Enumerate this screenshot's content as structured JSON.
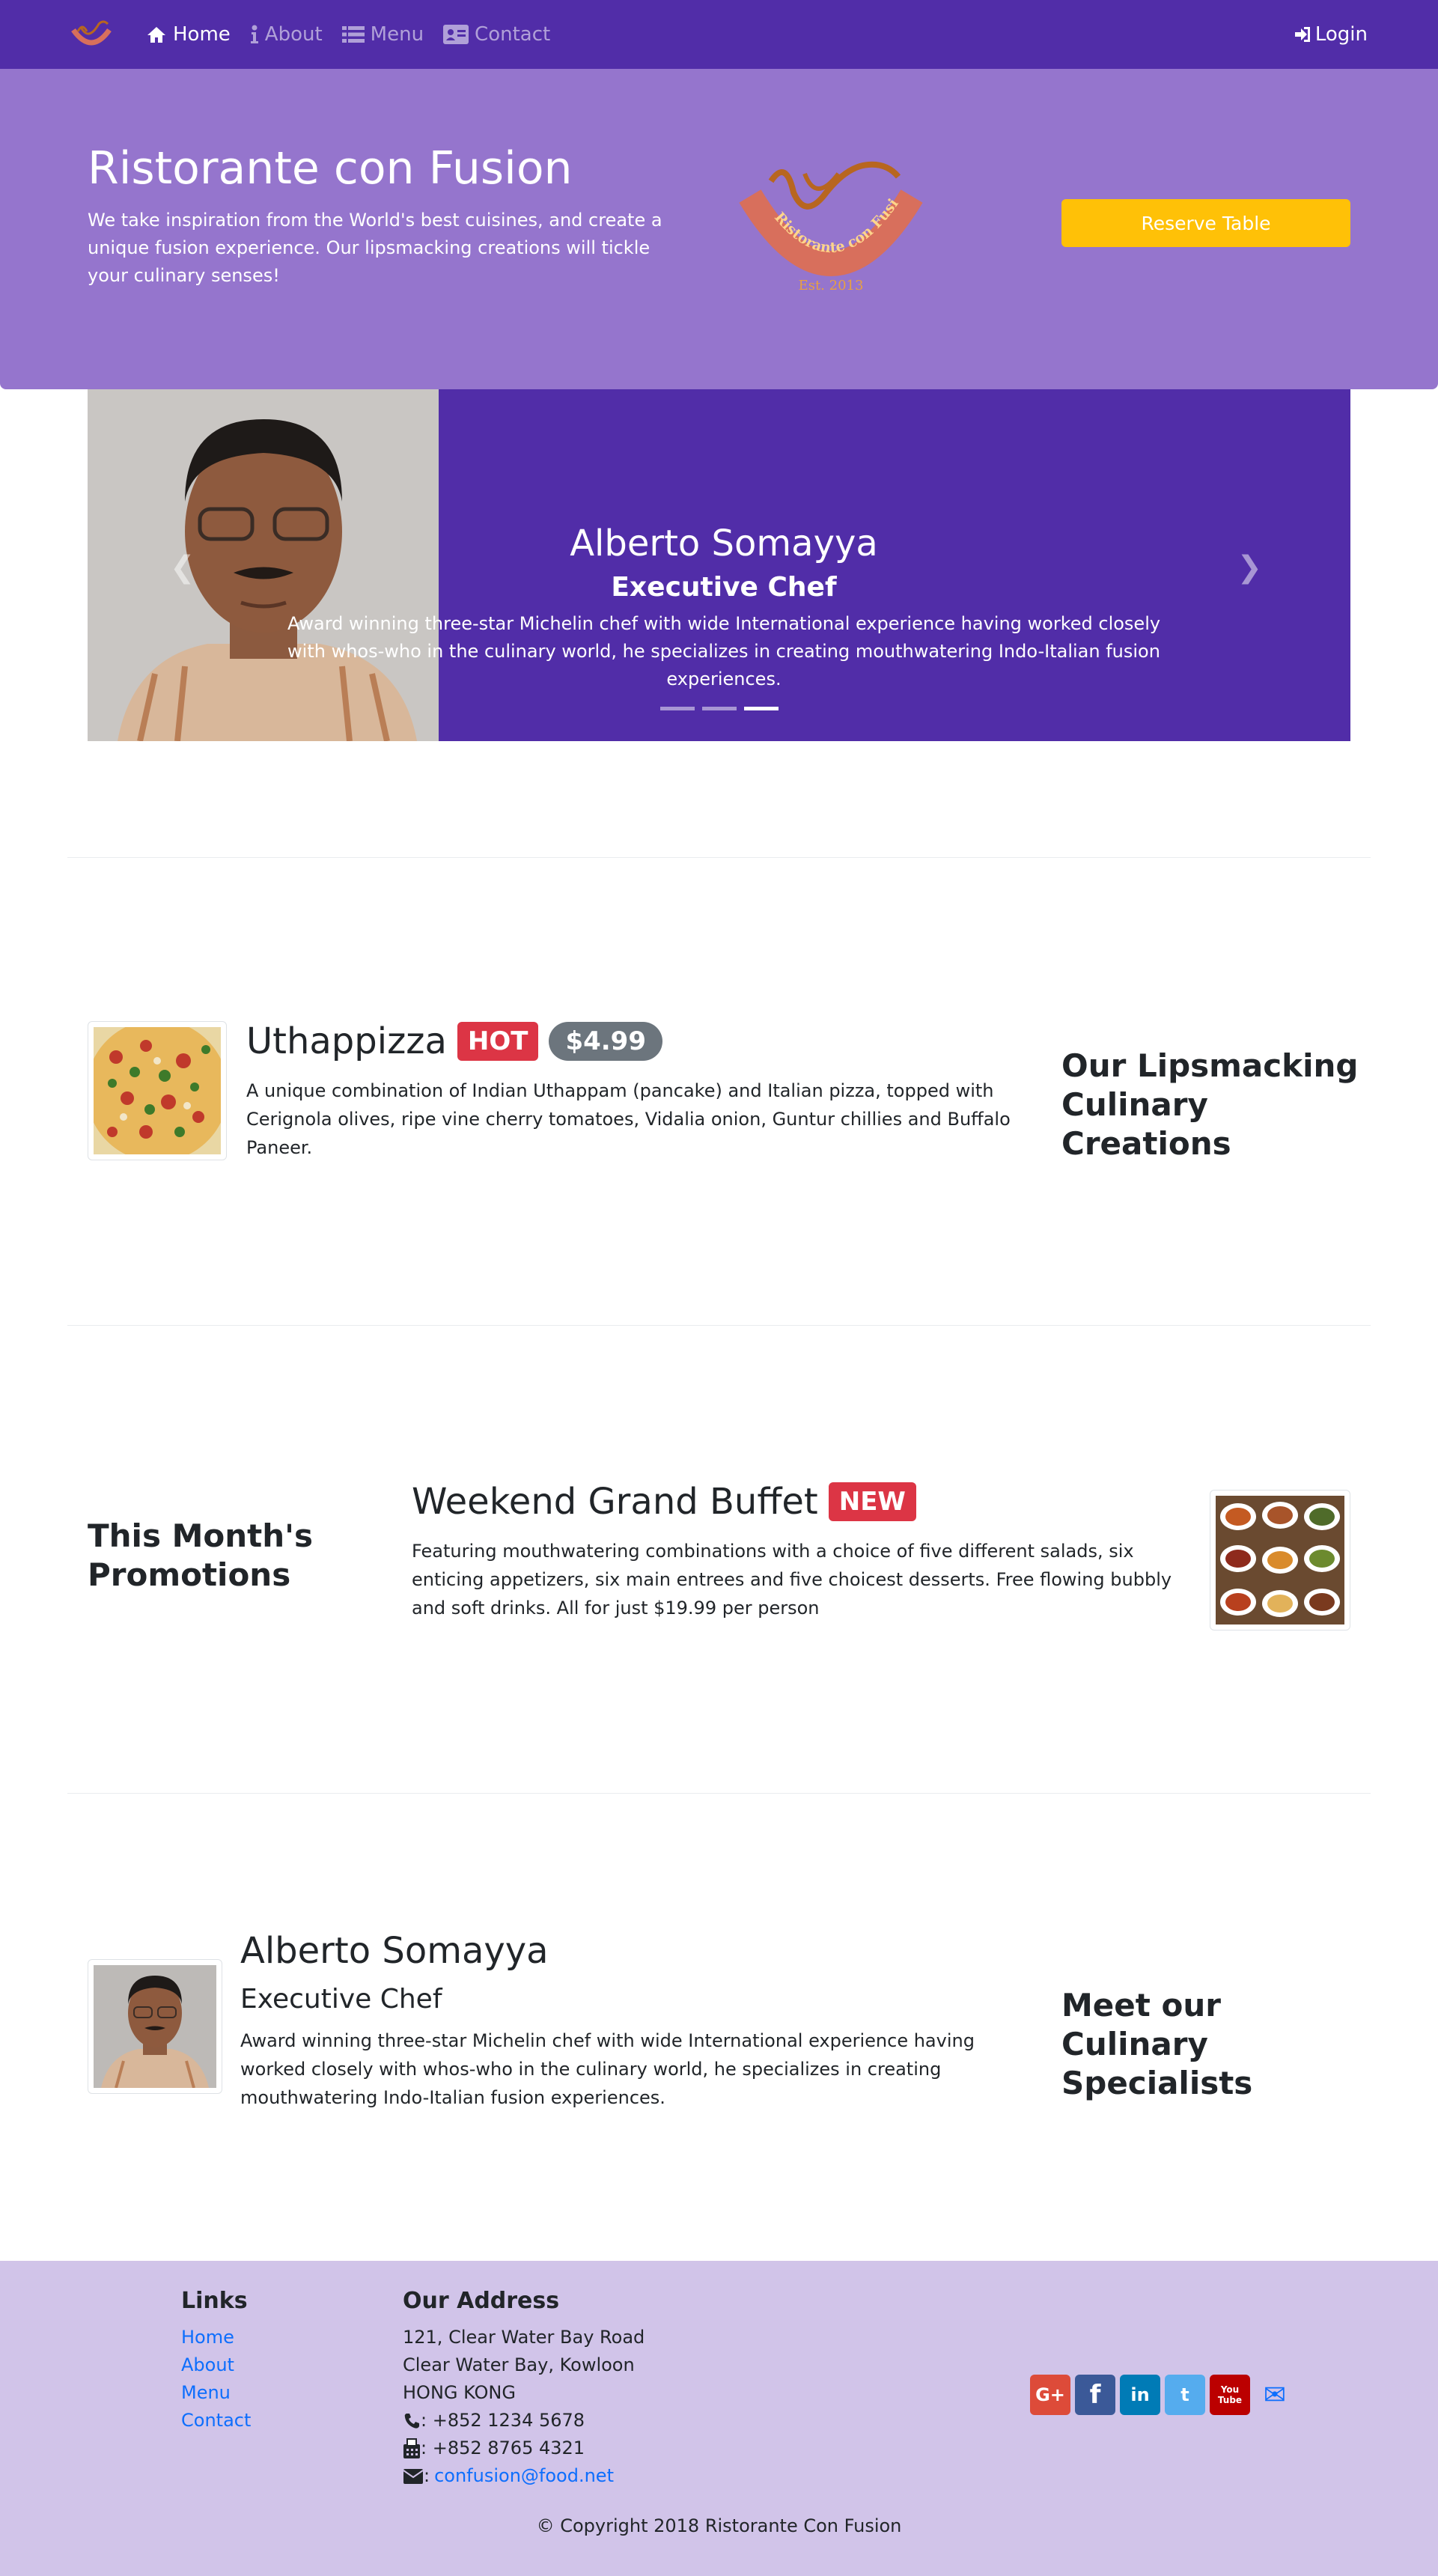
{
  "navbar": {
    "items": [
      {
        "label": "Home",
        "icon": "home-icon",
        "active": true
      },
      {
        "label": "About",
        "icon": "info-icon",
        "active": false
      },
      {
        "label": "Menu",
        "icon": "list-icon",
        "active": false
      },
      {
        "label": "Contact",
        "icon": "address-card-icon",
        "active": false
      }
    ],
    "login_label": "Login"
  },
  "jumbotron": {
    "title": "Ristorante con Fusion",
    "text": "We take inspiration from the World's best cuisines, and create a unique fusion experience. Our lipsmacking creations will tickle your culinary senses!",
    "logo_text": "Ristorante con Fusion",
    "logo_est": "Est. 2013",
    "reserve_label": "Reserve Table"
  },
  "carousel": {
    "name": "Alberto Somayya",
    "role": "Executive Chef",
    "text": "Award winning three-star Michelin chef with wide International experience having worked closely with whos-who in the culinary world, he specializes in creating mouthwatering Indo-Italian fusion experiences.",
    "active_index": 2,
    "slide_count": 3
  },
  "dish": {
    "name": "Uthappizza",
    "badge": "HOT",
    "price": "$4.99",
    "text": "A unique combination of Indian Uthappam (pancake) and Italian pizza, topped with Cerignola olives, ripe vine cherry tomatoes, Vidalia onion, Guntur chillies and Buffalo Paneer.",
    "side_heading": "Our Lipsmacking Culinary Creations"
  },
  "promotion": {
    "name": "Weekend Grand Buffet",
    "badge": "NEW",
    "text": "Featuring mouthwatering combinations with a choice of five different salads, six enticing appetizers, six main entrees and five choicest desserts. Free flowing bubbly and soft drinks. All for just $19.99 per person",
    "side_heading": "This Month's Promotions"
  },
  "leader": {
    "name": "Alberto Somayya",
    "role": "Executive Chef",
    "text": "Award winning three-star Michelin chef with wide International experience having worked closely with whos-who in the culinary world, he specializes in creating mouthwatering Indo-Italian fusion experiences.",
    "side_heading": "Meet our Culinary Specialists"
  },
  "footer": {
    "links_heading": "Links",
    "links": [
      "Home",
      "About",
      "Menu",
      "Contact"
    ],
    "address_heading": "Our Address",
    "address_lines": [
      "121, Clear Water Bay Road",
      "Clear Water Bay, Kowloon",
      "HONG KONG"
    ],
    "phone": ": +852 1234 5678",
    "fax": ": +852 8765 4321",
    "email_prefix": ":",
    "email": "confusion@food.net",
    "social": [
      {
        "name": "google-plus-icon",
        "label": "G+",
        "color": "#DD4B39"
      },
      {
        "name": "facebook-icon",
        "label": "f",
        "color": "#3B5998"
      },
      {
        "name": "linkedin-icon",
        "label": "in",
        "color": "#007BB6"
      },
      {
        "name": "twitter-icon",
        "label": "t",
        "color": "#55ACEE"
      },
      {
        "name": "youtube-icon",
        "label": "You Tube",
        "color": "#BB0000"
      },
      {
        "name": "mail-icon",
        "label": "✉",
        "color": "#0d6efd"
      }
    ],
    "copyright": "© Copyright 2018 Ristorante Con Fusion"
  },
  "colors": {
    "primary": "#512DA8",
    "primary_light": "#9575CD",
    "footer_bg": "#D1C4E9",
    "warning": "#FFC107",
    "danger": "#DC3545",
    "secondary": "#6C757D"
  }
}
